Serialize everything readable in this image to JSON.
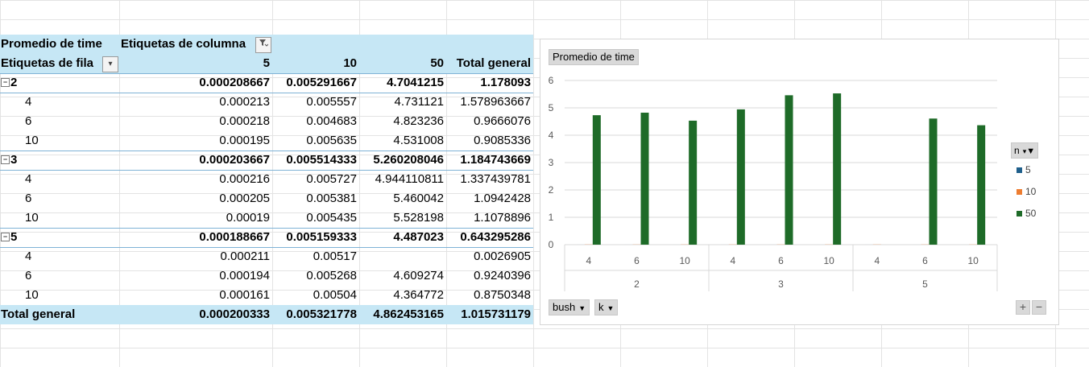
{
  "pivot": {
    "header_value_label": "Promedio de time",
    "column_labels_title": "Etiquetas de columna",
    "row_labels_title": "Etiquetas de fila",
    "column_headers": [
      "5",
      "10",
      "50",
      "Total general"
    ],
    "groups": [
      {
        "label": "2",
        "values": [
          "0.000208667",
          "0.005291667",
          "4.7041215",
          "1.178093"
        ],
        "rows": [
          {
            "label": "4",
            "values": [
              "0.000213",
              "0.005557",
              "4.731121",
              "1.578963667"
            ]
          },
          {
            "label": "6",
            "values": [
              "0.000218",
              "0.004683",
              "4.823236",
              "0.9666076"
            ]
          },
          {
            "label": "10",
            "values": [
              "0.000195",
              "0.005635",
              "4.531008",
              "0.9085336"
            ]
          }
        ]
      },
      {
        "label": "3",
        "values": [
          "0.000203667",
          "0.005514333",
          "5.260208046",
          "1.184743669"
        ],
        "rows": [
          {
            "label": "4",
            "values": [
              "0.000216",
              "0.005727",
              "4.944110811",
              "1.337439781"
            ]
          },
          {
            "label": "6",
            "values": [
              "0.000205",
              "0.005381",
              "5.460042",
              "1.0942428"
            ]
          },
          {
            "label": "10",
            "values": [
              "0.00019",
              "0.005435",
              "5.528198",
              "1.1078896"
            ]
          }
        ]
      },
      {
        "label": "5",
        "values": [
          "0.000188667",
          "0.005159333",
          "4.487023",
          "0.643295286"
        ],
        "rows": [
          {
            "label": "4",
            "values": [
              "0.000211",
              "0.00517",
              "",
              "0.0026905"
            ]
          },
          {
            "label": "6",
            "values": [
              "0.000194",
              "0.005268",
              "4.609274",
              "0.9240396"
            ]
          },
          {
            "label": "10",
            "values": [
              "0.000161",
              "0.00504",
              "4.364772",
              "0.8750348"
            ]
          }
        ]
      }
    ],
    "grand_total": {
      "label": "Total general",
      "values": [
        "0.000200333",
        "0.005321778",
        "4.862453165",
        "1.015731179"
      ]
    },
    "collapse_symbol": "−",
    "filter_icon": "filter-dropdown-icon",
    "dropdown_icon": "chevron-down-icon"
  },
  "chart_controls": {
    "value_field": "Promedio de time",
    "axis_fields": [
      "bush",
      "k"
    ],
    "legend_field": "n",
    "zoom_in": "+",
    "zoom_out": "−"
  },
  "colors": {
    "series_5": "#1f5f8b",
    "series_10": "#ed7d31",
    "series_50": "#1e6b28",
    "pivot_header": "#c6e7f5"
  },
  "chart_data": {
    "type": "bar",
    "title": "",
    "xlabel": "",
    "ylabel": "",
    "ylim": [
      0,
      6
    ],
    "yticks": [
      0,
      1,
      2,
      3,
      4,
      5,
      6
    ],
    "grid": true,
    "legend_position": "right",
    "groups": [
      {
        "label": "2",
        "categories": [
          "4",
          "6",
          "10"
        ]
      },
      {
        "label": "3",
        "categories": [
          "4",
          "6",
          "10"
        ]
      },
      {
        "label": "5",
        "categories": [
          "4",
          "6",
          "10"
        ]
      }
    ],
    "series": [
      {
        "name": "5",
        "values": [
          0.000213,
          0.000218,
          0.000195,
          0.000216,
          0.000205,
          0.00019,
          0.000211,
          0.000194,
          0.000161
        ]
      },
      {
        "name": "10",
        "values": [
          0.005557,
          0.004683,
          0.005635,
          0.005727,
          0.005381,
          0.005435,
          0.00517,
          0.005268,
          0.00504
        ]
      },
      {
        "name": "50",
        "values": [
          4.731121,
          4.823236,
          4.531008,
          4.944110811,
          5.460042,
          5.528198,
          null,
          4.609274,
          4.364772
        ]
      }
    ]
  }
}
